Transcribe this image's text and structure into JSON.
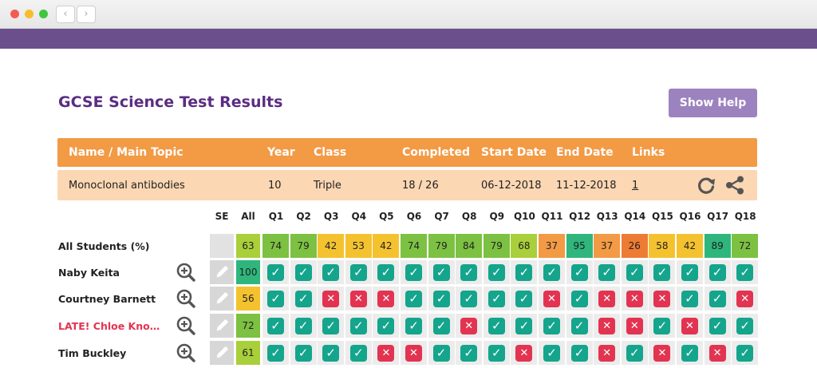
{
  "browser": {
    "back": "‹",
    "forward": "›"
  },
  "page": {
    "title": "GCSE Science Test Results",
    "help_button": "Show Help"
  },
  "header": {
    "name": "Name / Main Topic",
    "year": "Year",
    "class": "Class",
    "completed": "Completed",
    "start": "Start Date",
    "end": "End Date",
    "links": "Links"
  },
  "test": {
    "name": "Monoclonal antibodies",
    "year": "10",
    "class": "Triple",
    "completed": "18 / 26",
    "start": "06-12-2018",
    "end": "11-12-2018",
    "links": "1"
  },
  "columns": {
    "se": "SE",
    "all": "All",
    "questions": [
      "Q1",
      "Q2",
      "Q3",
      "Q4",
      "Q5",
      "Q6",
      "Q7",
      "Q8",
      "Q9",
      "Q10",
      "Q11",
      "Q12",
      "Q13",
      "Q14",
      "Q15",
      "Q16",
      "Q17",
      "Q18"
    ]
  },
  "summary": {
    "label": "All Students (%)",
    "all": "63",
    "values": [
      "74",
      "79",
      "42",
      "53",
      "42",
      "74",
      "79",
      "84",
      "79",
      "68",
      "37",
      "95",
      "37",
      "26",
      "58",
      "42",
      "89",
      "72"
    ]
  },
  "students": [
    {
      "name": "Naby Keita",
      "late": false,
      "all": "100",
      "marks": [
        1,
        1,
        1,
        1,
        1,
        1,
        1,
        1,
        1,
        1,
        1,
        1,
        1,
        1,
        1,
        1,
        1,
        1
      ]
    },
    {
      "name": "Courtney Barnett",
      "late": false,
      "all": "56",
      "marks": [
        1,
        1,
        0,
        0,
        0,
        1,
        1,
        1,
        1,
        1,
        0,
        1,
        0,
        0,
        0,
        1,
        1,
        0
      ]
    },
    {
      "name": "LATE! Chloe Kno…",
      "late": true,
      "all": "72",
      "marks": [
        1,
        1,
        1,
        1,
        1,
        1,
        1,
        0,
        1,
        1,
        1,
        1,
        0,
        0,
        1,
        0,
        1,
        1
      ]
    },
    {
      "name": "Tim Buckley",
      "late": false,
      "all": "61",
      "marks": [
        1,
        1,
        1,
        1,
        0,
        0,
        1,
        1,
        1,
        0,
        1,
        1,
        0,
        1,
        0,
        1,
        0,
        1
      ]
    }
  ],
  "colors": {
    "high": "#2eb67d",
    "good": "#7cc142",
    "mid_high": "#a9cf3a",
    "mid": "#f5c22f",
    "low": "#f39a45",
    "very_low": "#ee7b33",
    "tick": "#14a58c",
    "cross": "#e23451",
    "brand": "#6a4f8c"
  },
  "icons": {
    "zoom": "zoom-plus-icon",
    "pencil": "pencil-icon",
    "refresh": "refresh-icon",
    "share": "share-icon"
  }
}
